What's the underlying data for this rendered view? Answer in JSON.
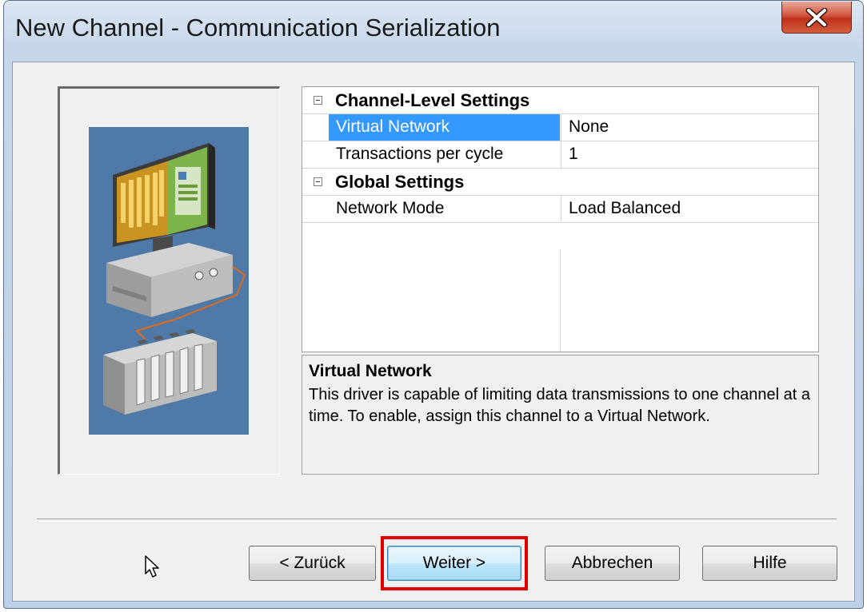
{
  "window": {
    "title": "New Channel - Communication Serialization"
  },
  "property_grid": {
    "categories": [
      {
        "label": "Channel-Level Settings",
        "properties": [
          {
            "name": "Virtual Network",
            "value": "None",
            "selected": true
          },
          {
            "name": "Transactions per cycle",
            "value": "1",
            "selected": false
          }
        ]
      },
      {
        "label": "Global Settings",
        "properties": [
          {
            "name": "Network Mode",
            "value": "Load Balanced",
            "selected": false
          }
        ]
      }
    ]
  },
  "description": {
    "title": "Virtual Network",
    "text": "This driver is capable of limiting data transmissions to one channel at a time. To enable, assign this channel to a Virtual Network."
  },
  "buttons": {
    "back_label": "< Zurück",
    "next_label": "Weiter >",
    "cancel_label": "Abbrechen",
    "help_label": "Hilfe"
  },
  "colors": {
    "selection": "#3399ff",
    "illustration_bg": "#4f79a6",
    "highlight_box": "#e00000",
    "close_button": "#c0311d"
  },
  "icons": {
    "close": "close-icon",
    "collapse": "collapse-icon",
    "cursor": "mouse-cursor-icon"
  }
}
